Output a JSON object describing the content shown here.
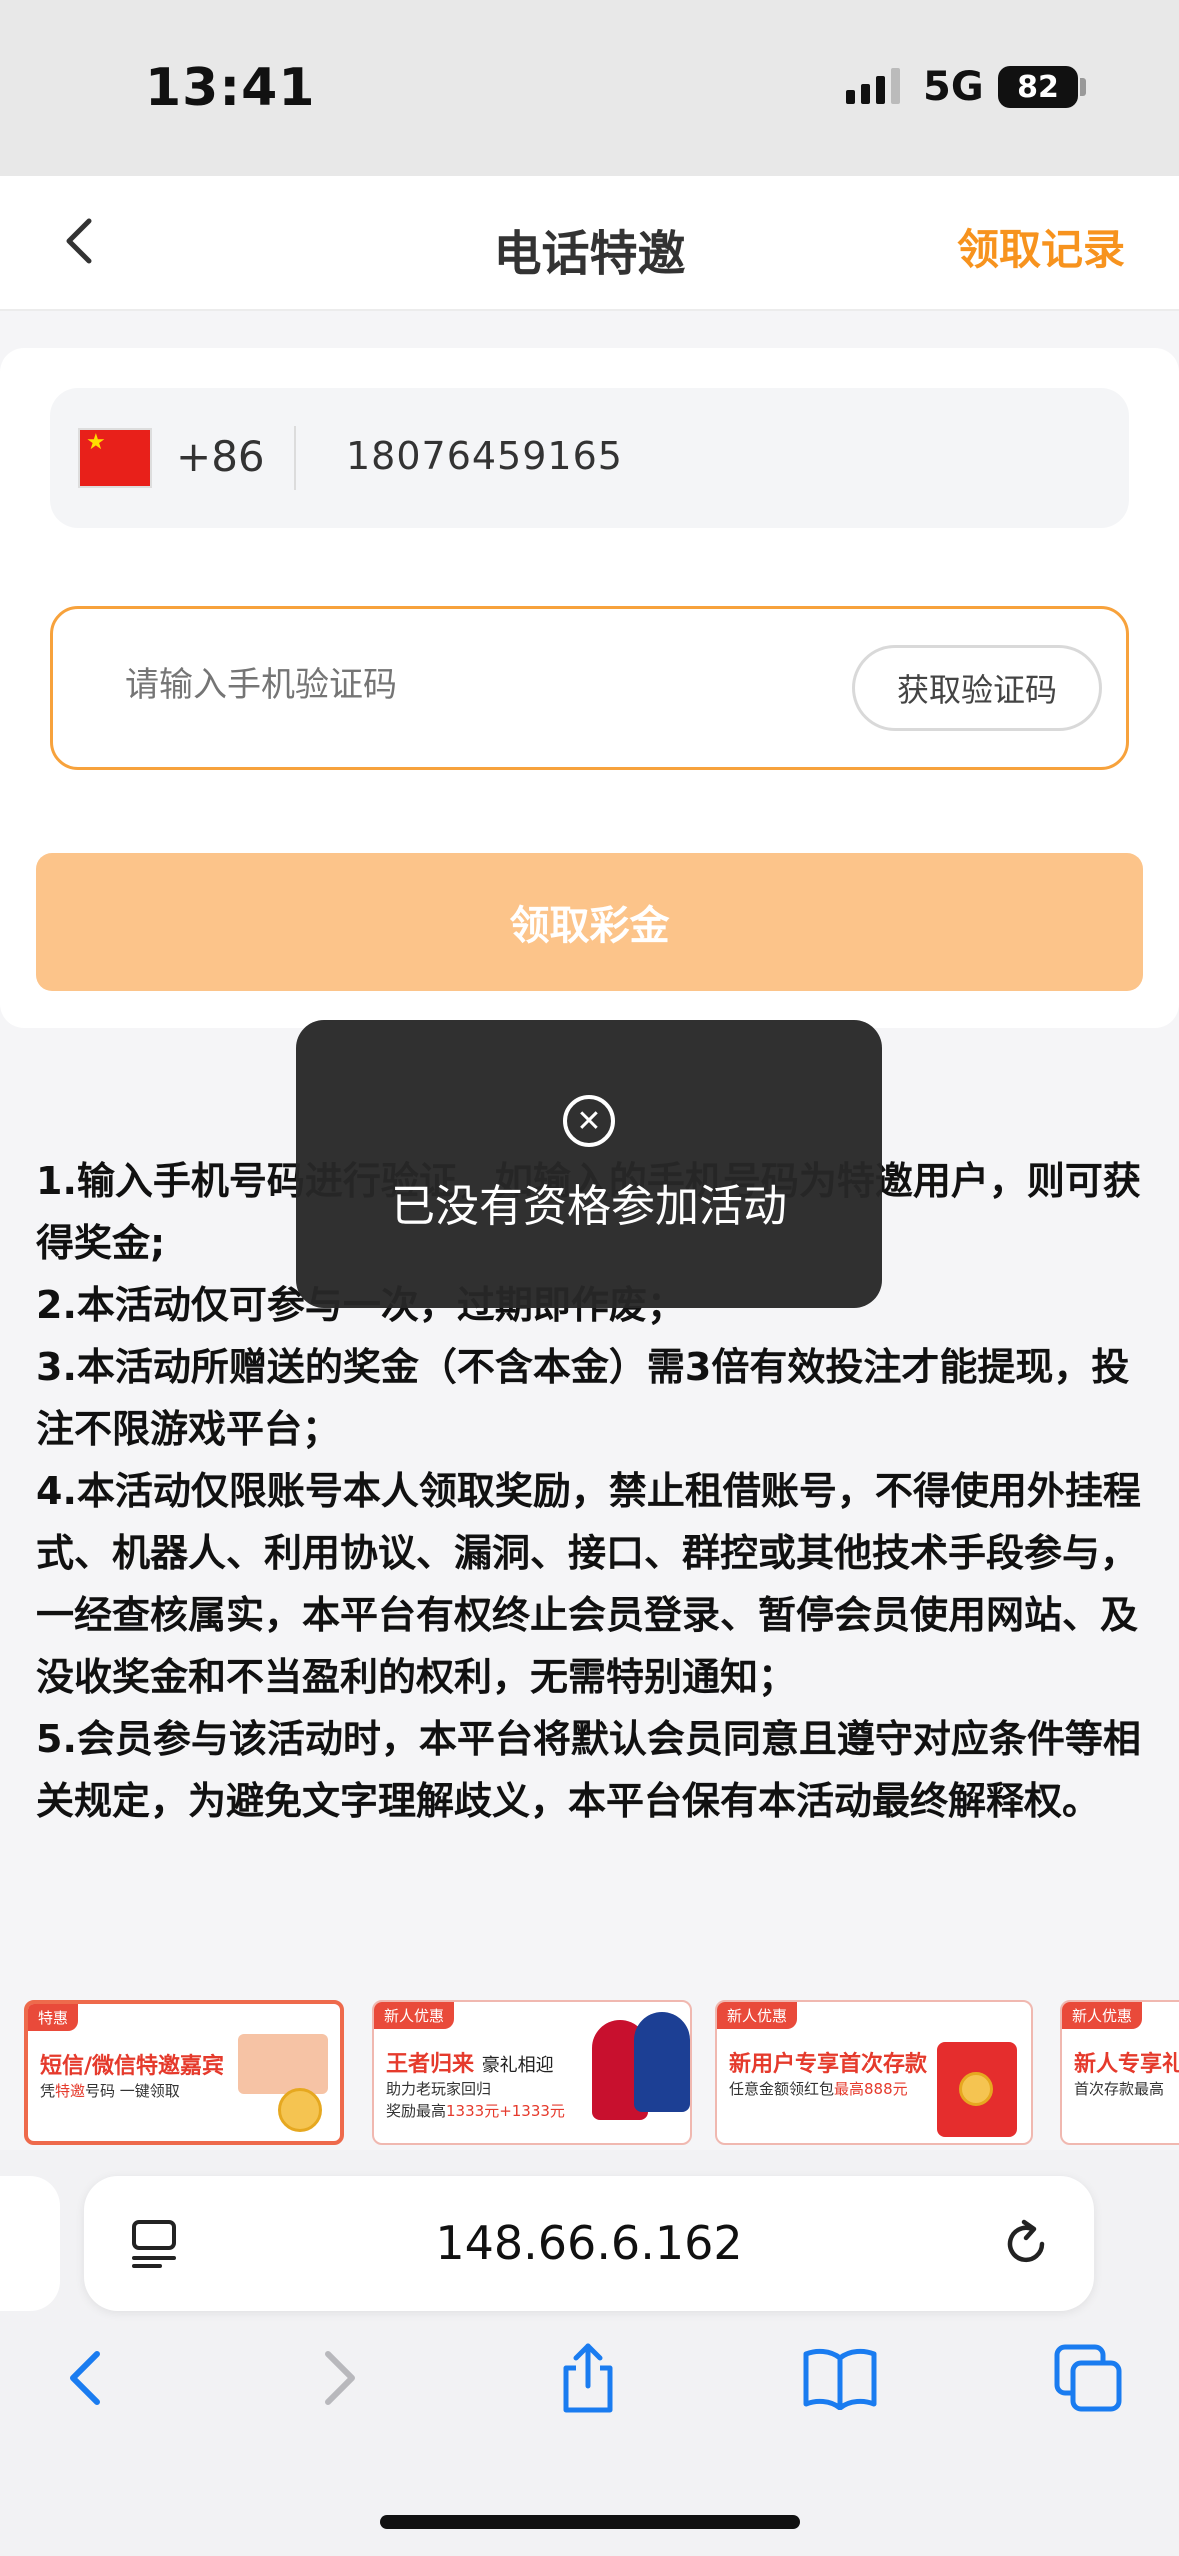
{
  "status_bar": {
    "time": "13:41",
    "network": "5G",
    "battery": "82"
  },
  "header": {
    "title": "电话特邀",
    "records_label": "领取记录"
  },
  "form": {
    "country_code": "+86",
    "phone_number": "18076459165",
    "code_placeholder": "请输入手机验证码",
    "get_code_label": "获取验证码",
    "claim_label": "领取彩金"
  },
  "toast": {
    "message": "已没有资格参加活动"
  },
  "rules": [
    "1.输入手机号码进行验证，如输入的手机号码为特邀用户，则可获得奖金;",
    "2.本活动仅可参与一次，过期即作废；",
    "3.本活动所赠送的奖金（不含本金）需3倍有效投注才能提现，投注不限游戏平台；",
    "4.本活动仅限账号本人领取奖励，禁止租借账号，不得使用外挂程式、机器人、利用协议、漏洞、接口、群控或其他技术手段参与，一经查核属实，本平台有权终止会员登录、暂停会员使用网站、及没收奖金和不当盈利的权利，无需特别通知；",
    "5.会员参与该活动时，本平台将默认会员同意且遵守对应条件等相关规定，为避免文字理解歧义，本平台保有本活动最终解释权。"
  ],
  "banners": [
    {
      "tag": "特惠",
      "title": "短信/微信特邀嘉宾",
      "sub_a": "凭",
      "sub_b": "特邀",
      "sub_c": "号码  一键领取"
    },
    {
      "tag": "新人优惠",
      "title": "王者归来",
      "title_extra": "豪礼相迎",
      "sub": "助力老玩家回归",
      "sub2_a": "奖励最高",
      "sub2_b": "1333元+1333元"
    },
    {
      "tag": "新人优惠",
      "title": "新用户专享首次存款",
      "sub_a": "任意金额领红包",
      "sub_b": "最高888元"
    },
    {
      "tag": "新人优惠",
      "title": "新人专享礼",
      "sub": "首次存款最高"
    }
  ],
  "browser": {
    "url": "148.66.6.162"
  },
  "icons": [
    "back-chevron-icon",
    "china-flag-icon",
    "close-circle-icon",
    "reader-menu-icon",
    "reload-icon",
    "nav-back-icon",
    "nav-forward-icon",
    "share-icon",
    "bookmarks-icon",
    "tabs-icon"
  ],
  "colors": {
    "accent": "#f7931e",
    "button_disabled": "#fcc48a",
    "input_border": "#f7a23c"
  }
}
